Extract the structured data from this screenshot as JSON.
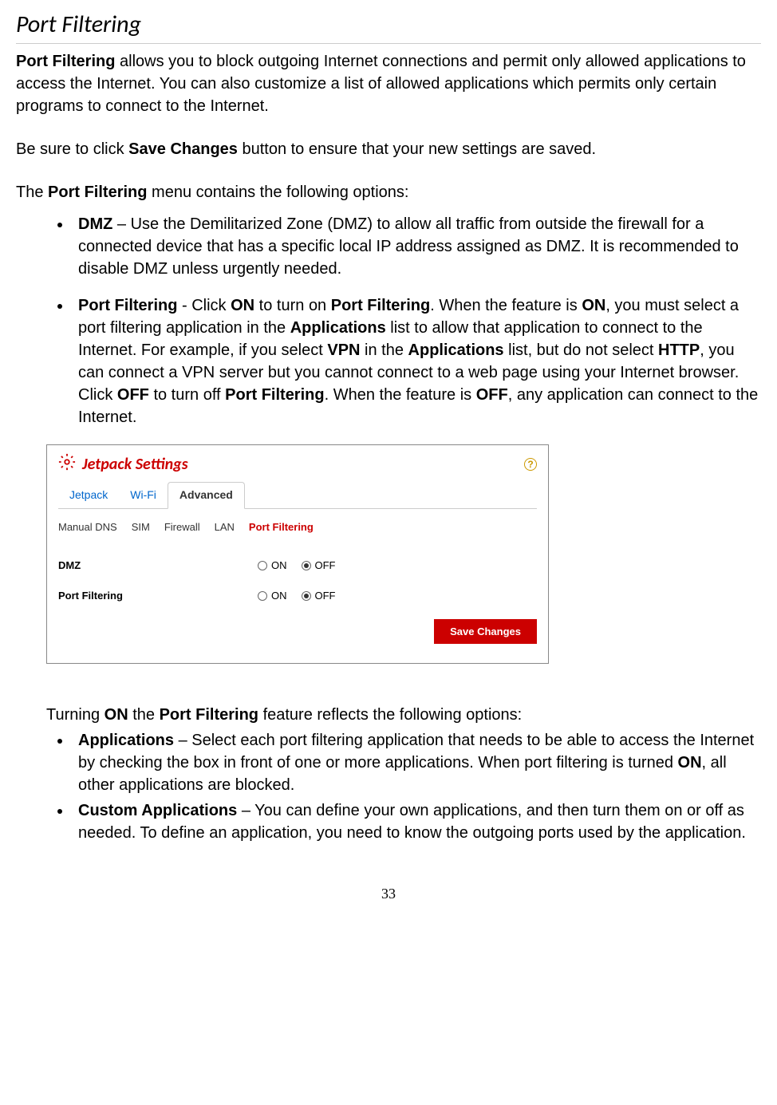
{
  "title": "Port Filtering",
  "para1_strong": "Port Filtering",
  "para1_rest": " allows you to block outgoing Internet connections and permit only allowed applications to access the Internet. You can also customize a list of allowed applications which permits only certain programs to connect to the Internet.",
  "para2_a": "Be sure to click ",
  "para2_strong": "Save Changes",
  "para2_b": " button to ensure that your new settings are saved.",
  "para3_a": "The ",
  "para3_strong": "Port Filtering",
  "para3_b": " menu contains the following options:",
  "bullets": {
    "dmz": {
      "strong": "DMZ",
      "text": " – Use the Demilitarized Zone (DMZ) to allow all traffic from outside the firewall for a connected device that has a specific local IP address assigned as DMZ. It is recommended to disable DMZ unless urgently needed."
    },
    "pf": {
      "b1": "Port Filtering",
      "t1": " - Click ",
      "b2": "ON",
      "t2": " to turn on ",
      "b3": "Port Filtering",
      "t3": ". When the feature is ",
      "b4": "ON",
      "t4": ", you must select a port filtering application in the ",
      "b5": "Applications",
      "t5": " list to allow that application to connect to the Internet. For example, if you select ",
      "b6": "VPN",
      "t6": " in the ",
      "b7": "Applications",
      "t7": " list, but do not select ",
      "b8": "HTTP",
      "t8": ", you can connect a VPN server but you cannot connect to a web page using your Internet browser. Click ",
      "b9": "OFF",
      "t9": " to turn off ",
      "b10": "Port Filtering",
      "t10": ". When the feature is ",
      "b11": "OFF",
      "t11": ", any application can connect to the Internet."
    }
  },
  "ui": {
    "title": "Jetpack Settings",
    "help": "?",
    "tabs": {
      "jetpack": "Jetpack",
      "wifi": "Wi-Fi",
      "advanced": "Advanced"
    },
    "subtabs": {
      "manual_dns": "Manual DNS",
      "sim": "SIM",
      "firewall": "Firewall",
      "lan": "LAN",
      "port_filtering": "Port Filtering"
    },
    "settings": {
      "dmz_label": "DMZ",
      "pf_label": "Port Filtering",
      "on": "ON",
      "off": "OFF"
    },
    "save": "Save Changes"
  },
  "post": {
    "intro_a": "Turning ",
    "intro_b1": "ON",
    "intro_b": " the ",
    "intro_b2": "Port Filtering",
    "intro_c": " feature reflects the following options:",
    "apps": {
      "strong": "Applications",
      "t1": " – Select each port filtering application that needs to be able to access the Internet by checking the box in front of one or more applications. When port filtering is turned ",
      "b1": "ON",
      "t2": ", all other applications are blocked."
    },
    "custom": {
      "strong": "Custom Applications",
      "text": " – You can define your own applications, and then turn them on or off as needed. To define an application, you need to know the outgoing ports used by the application."
    }
  },
  "page_number": "33"
}
